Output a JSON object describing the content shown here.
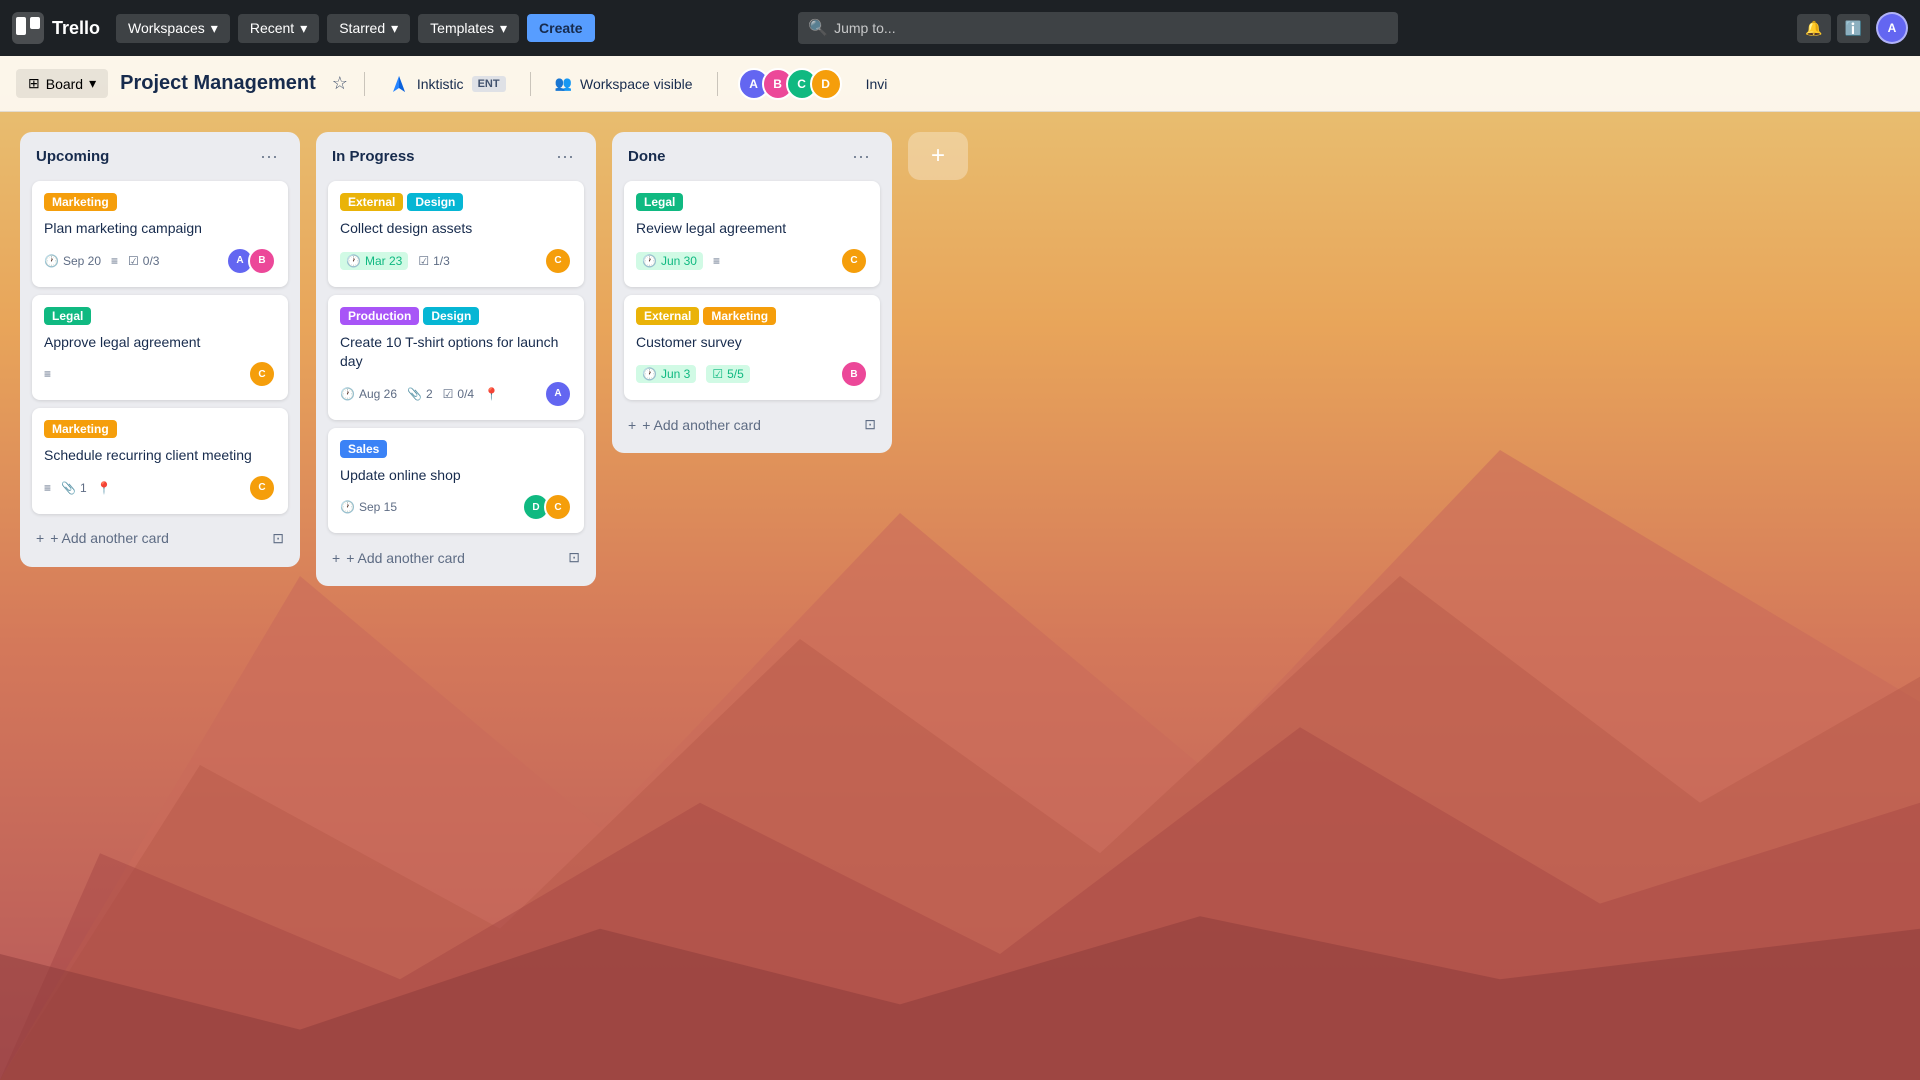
{
  "nav": {
    "logo_text": "Trello",
    "workspaces_label": "Workspaces",
    "search_placeholder": "Jump to...",
    "avatars": [
      {
        "id": "av1",
        "color": "#6366f1",
        "initials": "A"
      },
      {
        "id": "av2",
        "color": "#ec4899",
        "initials": "B"
      },
      {
        "id": "av3",
        "color": "#10b981",
        "initials": "C"
      },
      {
        "id": "av4",
        "color": "#f59e0b",
        "initials": "D"
      }
    ]
  },
  "board_header": {
    "board_view_label": "Board",
    "board_title": "Project Management",
    "workspace_name": "Inktistic",
    "workspace_badge": "ENT",
    "workspace_visible_label": "Workspace visible",
    "invite_label": "Invi"
  },
  "lists": [
    {
      "id": "upcoming",
      "title": "Upcoming",
      "cards": [
        {
          "id": "c1",
          "labels": [
            {
              "text": "Marketing",
              "color": "orange"
            }
          ],
          "title": "Plan marketing campaign",
          "meta": [
            {
              "type": "date",
              "value": "Sep 20"
            },
            {
              "type": "lines",
              "value": ""
            },
            {
              "type": "checklist",
              "value": "0/3"
            }
          ],
          "avatars": [
            "ca-1",
            "ca-2"
          ]
        },
        {
          "id": "c2",
          "labels": [
            {
              "text": "Legal",
              "color": "green"
            }
          ],
          "title": "Approve legal agreement",
          "meta": [
            {
              "type": "lines",
              "value": ""
            }
          ],
          "avatars": [
            "ca-3"
          ]
        },
        {
          "id": "c3",
          "labels": [
            {
              "text": "Marketing",
              "color": "orange"
            }
          ],
          "title": "Schedule recurring client meeting",
          "meta": [
            {
              "type": "lines",
              "value": ""
            },
            {
              "type": "attachment",
              "value": "1"
            },
            {
              "type": "pin",
              "value": ""
            }
          ],
          "avatars": [
            "ca-3"
          ]
        }
      ],
      "add_card_label": "+ Add another card"
    },
    {
      "id": "in-progress",
      "title": "In Progress",
      "cards": [
        {
          "id": "c4",
          "labels": [
            {
              "text": "External",
              "color": "yellow"
            },
            {
              "text": "Design",
              "color": "cyan"
            }
          ],
          "title": "Collect design assets",
          "meta": [
            {
              "type": "date",
              "value": "Mar 23",
              "style": "green"
            },
            {
              "type": "checklist",
              "value": "1/3"
            }
          ],
          "avatars": [
            "ca-3"
          ]
        },
        {
          "id": "c5",
          "labels": [
            {
              "text": "Production",
              "color": "purple"
            },
            {
              "text": "Design",
              "color": "cyan"
            }
          ],
          "title": "Create 10 T-shirt options for launch day",
          "meta": [
            {
              "type": "date",
              "value": "Aug 26"
            },
            {
              "type": "attachment",
              "value": "2"
            },
            {
              "type": "checklist",
              "value": "0/4"
            },
            {
              "type": "pin",
              "value": ""
            }
          ],
          "avatars": [
            "ca-1"
          ]
        },
        {
          "id": "c6",
          "labels": [
            {
              "text": "Sales",
              "color": "blue"
            }
          ],
          "title": "Update online shop",
          "meta": [
            {
              "type": "date",
              "value": "Sep 15"
            }
          ],
          "avatars": [
            "ca-4",
            "ca-3"
          ]
        }
      ],
      "add_card_label": "+ Add another card"
    },
    {
      "id": "done",
      "title": "Done",
      "cards": [
        {
          "id": "c7",
          "labels": [
            {
              "text": "Legal",
              "color": "green"
            }
          ],
          "title": "Review legal agreement",
          "meta": [
            {
              "type": "date",
              "value": "Jun 30",
              "style": "green"
            },
            {
              "type": "lines",
              "value": ""
            }
          ],
          "avatars": [
            "ca-3"
          ]
        },
        {
          "id": "c8",
          "labels": [
            {
              "text": "External",
              "color": "yellow"
            },
            {
              "text": "Marketing",
              "color": "orange"
            }
          ],
          "title": "Customer survey",
          "meta": [
            {
              "type": "date",
              "value": "Jun 3",
              "style": "green"
            },
            {
              "type": "checklist",
              "value": "5/5",
              "style": "green"
            }
          ],
          "avatars": [
            "ca-2"
          ]
        }
      ],
      "add_card_label": "+ Add another card"
    }
  ]
}
